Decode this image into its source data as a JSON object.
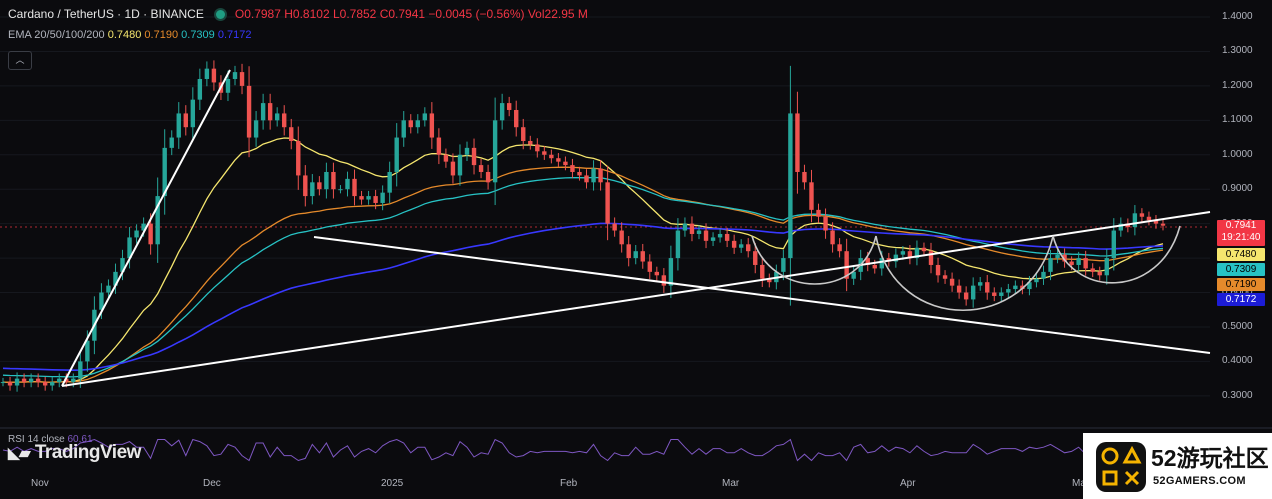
{
  "header": {
    "symbol": "Cardano / TetherUS · 1D · BINANCE",
    "o_label": "O",
    "o": "0.7987",
    "h_label": "H",
    "h": "0.8102",
    "l_label": "L",
    "l": "0.7852",
    "c_label": "C",
    "c": "0.7941",
    "change": "−0.0045 (−0.56%)",
    "vol_label": "Vol",
    "vol": "22.95 M",
    "ema_label": "EMA 20/50/100/200",
    "ema": [
      "0.7480",
      "0.7190",
      "0.7309",
      "0.7172"
    ]
  },
  "price_axis": [
    "1.4000",
    "1.3000",
    "1.2000",
    "1.1000",
    "1.0000",
    "0.9000",
    "0.8000",
    "0.7000",
    "0.6000",
    "0.5000",
    "0.4000",
    "0.3000"
  ],
  "price_boxes": {
    "last": "0.7941",
    "countdown": "19:21:40",
    "ema20": "0.7480",
    "ema100": "0.7309",
    "ema50": "0.7190",
    "ema200": "0.7172"
  },
  "time_axis": [
    "Nov",
    "Dec",
    "2025",
    "Feb",
    "Mar",
    "Apr",
    "Ma"
  ],
  "rsi": {
    "label": "RSI 14 close",
    "value": "60.61"
  },
  "brand": "TradingView",
  "watermark": {
    "name": "52游玩社区",
    "url": "52GAMERS.COM"
  },
  "colors": {
    "bg": "#0b0b0e",
    "up": "#26a69a",
    "down": "#ef5350",
    "ema20": "#f5e66e",
    "ema50": "#e58a2b",
    "ema100": "#27c2c4",
    "ema200": "#3838ff",
    "last_price": "#f23645",
    "rsi": "#7e57c2",
    "drawing": "#ffffff"
  },
  "chart_data": {
    "type": "candlestick",
    "title": "Cardano / TetherUS · 1D · BINANCE",
    "x_ticks": [
      "Nov",
      "Dec",
      "2025",
      "Feb",
      "Mar",
      "Apr",
      "Ma"
    ],
    "y_ticks": [
      1.4,
      1.3,
      1.2,
      1.1,
      1.0,
      0.9,
      0.8,
      0.7,
      0.6,
      0.5,
      0.4,
      0.3
    ],
    "ylim": [
      0.25,
      1.42
    ],
    "last_close": 0.7941,
    "series_close": [
      0.34,
      0.33,
      0.35,
      0.34,
      0.35,
      0.34,
      0.33,
      0.34,
      0.35,
      0.34,
      0.35,
      0.4,
      0.46,
      0.55,
      0.6,
      0.62,
      0.66,
      0.7,
      0.76,
      0.78,
      0.8,
      0.74,
      0.88,
      1.02,
      1.05,
      1.12,
      1.08,
      1.16,
      1.22,
      1.25,
      1.21,
      1.18,
      1.22,
      1.24,
      1.2,
      1.05,
      1.1,
      1.15,
      1.1,
      1.12,
      1.08,
      1.04,
      0.94,
      0.88,
      0.92,
      0.9,
      0.95,
      0.9,
      0.9,
      0.93,
      0.88,
      0.87,
      0.88,
      0.86,
      0.89,
      0.95,
      1.05,
      1.1,
      1.08,
      1.1,
      1.12,
      1.05,
      1.0,
      0.98,
      0.94,
      1.0,
      1.02,
      0.97,
      0.95,
      0.92,
      1.1,
      1.15,
      1.13,
      1.08,
      1.04,
      1.03,
      1.01,
      1.0,
      0.99,
      0.98,
      0.97,
      0.95,
      0.94,
      0.92,
      0.96,
      0.92,
      0.8,
      0.78,
      0.74,
      0.7,
      0.72,
      0.69,
      0.66,
      0.65,
      0.62,
      0.7,
      0.78,
      0.8,
      0.77,
      0.78,
      0.75,
      0.76,
      0.77,
      0.75,
      0.73,
      0.74,
      0.72,
      0.68,
      0.64,
      0.63,
      0.66,
      0.7,
      1.12,
      0.95,
      0.92,
      0.84,
      0.82,
      0.78,
      0.74,
      0.72,
      0.64,
      0.66,
      0.7,
      0.68,
      0.67,
      0.7,
      0.69,
      0.71,
      0.72,
      0.7,
      0.73,
      0.72,
      0.68,
      0.65,
      0.64,
      0.62,
      0.6,
      0.58,
      0.62,
      0.63,
      0.6,
      0.59,
      0.6,
      0.61,
      0.62,
      0.61,
      0.63,
      0.64,
      0.66,
      0.7,
      0.71,
      0.69,
      0.68,
      0.7,
      0.67,
      0.66,
      0.65,
      0.7,
      0.78,
      0.8,
      0.79,
      0.83,
      0.82,
      0.81,
      0.8,
      0.7941
    ],
    "ema": [
      {
        "period": 20,
        "last": 0.748
      },
      {
        "period": 50,
        "last": 0.719
      },
      {
        "period": 100,
        "last": 0.7309
      },
      {
        "period": 200,
        "last": 0.7172
      }
    ],
    "trendlines": [
      {
        "from": [
          0.228,
          1.25
        ],
        "to": [
          0.952,
          0.85
        ]
      },
      {
        "from": [
          0.247,
          0.75
        ],
        "to": [
          0.952,
          0.43
        ]
      }
    ],
    "cup_and_handle_arcs": 3
  }
}
